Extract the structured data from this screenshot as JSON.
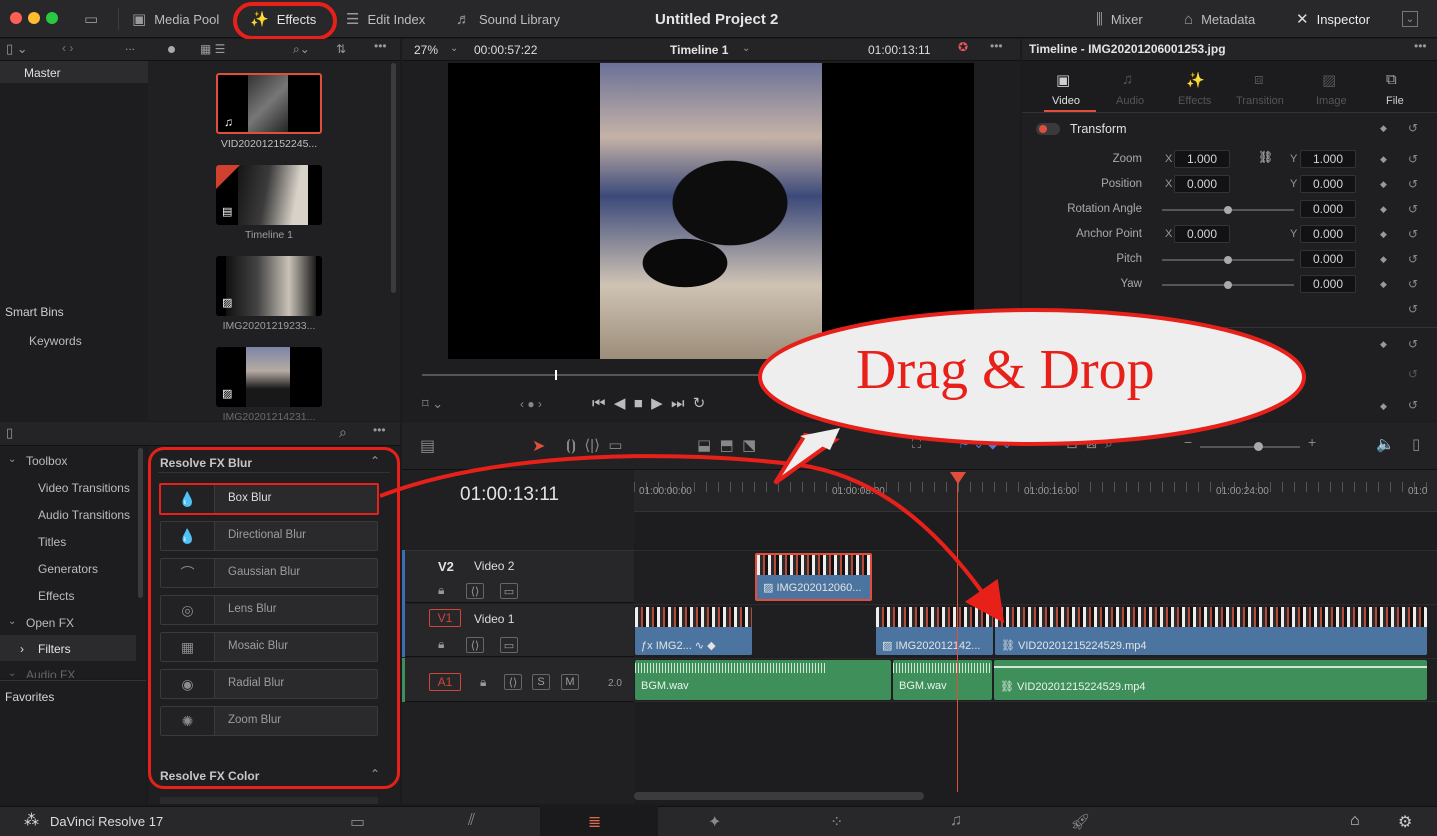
{
  "topbar": {
    "media_pool": "Media Pool",
    "effects": "Effects",
    "edit_index": "Edit Index",
    "sound_library": "Sound Library",
    "project_title": "Untitled Project 2",
    "mixer": "Mixer",
    "metadata": "Metadata",
    "inspector": "Inspector"
  },
  "viewer": {
    "zoom": "27%",
    "duration": "00:00:57:22",
    "timeline_name": "Timeline 1",
    "timecode": "01:00:13:11"
  },
  "media_pool": {
    "bins": [
      "Master",
      "Smart Bins",
      "Keywords"
    ],
    "items": [
      {
        "name": "VID202012152245..."
      },
      {
        "name": "Timeline 1"
      },
      {
        "name": "IMG20201219233..."
      },
      {
        "name": "IMG20201214231..."
      }
    ]
  },
  "effects_library": {
    "tree": [
      "Toolbox",
      "Video Transitions",
      "Audio Transitions",
      "Titles",
      "Generators",
      "Effects",
      "Open FX",
      "Filters",
      "Audio FX"
    ],
    "favorites": "Favorites",
    "group_title": "Resolve FX Blur",
    "items": [
      "Box Blur",
      "Directional Blur",
      "Gaussian Blur",
      "Lens Blur",
      "Mosaic Blur",
      "Radial Blur",
      "Zoom Blur"
    ],
    "next_group": "Resolve FX Color"
  },
  "inspector": {
    "header": "Timeline - IMG20201206001253.jpg",
    "tabs": [
      "Video",
      "Audio",
      "Effects",
      "Transition",
      "Image",
      "File"
    ],
    "section": "Transform",
    "zoom_label": "Zoom",
    "zoom_x": "1.000",
    "zoom_y": "1.000",
    "position_label": "Position",
    "position_x": "0.000",
    "position_y": "0.000",
    "rotation_label": "Rotation Angle",
    "rotation": "0.000",
    "anchor_label": "Anchor Point",
    "anchor_x": "0.000",
    "anchor_y": "0.000",
    "pitch_label": "Pitch",
    "pitch": "0.000",
    "yaw_label": "Yaw",
    "yaw": "0.000",
    "x": "X",
    "y": "Y"
  },
  "timeline": {
    "timecode": "01:00:13:11",
    "ruler": [
      "01:00:00:00",
      "01:00:08:00",
      "01:00:16:00",
      "01:00:24:00",
      "01:0"
    ],
    "tracks": [
      {
        "id": "V2",
        "name": "Video 2"
      },
      {
        "id": "V1",
        "name": "Video 1"
      },
      {
        "id": "A1",
        "name": "",
        "level": "2.0"
      }
    ],
    "clips": {
      "v2_clip": "IMG202012060...",
      "v1_a": "IMG2...",
      "v1_b": "IMG202012142...",
      "v1_c": "VID20201215224529.mp4",
      "a1_a": "BGM.wav",
      "a1_b": "BGM.wav",
      "a1_c": "VID20201215224529.mp4"
    },
    "audio_btns": {
      "s": "S",
      "m": "M"
    }
  },
  "annotation": {
    "callout": "Drag & Drop"
  },
  "footer": {
    "app_name": "DaVinci Resolve 17"
  }
}
